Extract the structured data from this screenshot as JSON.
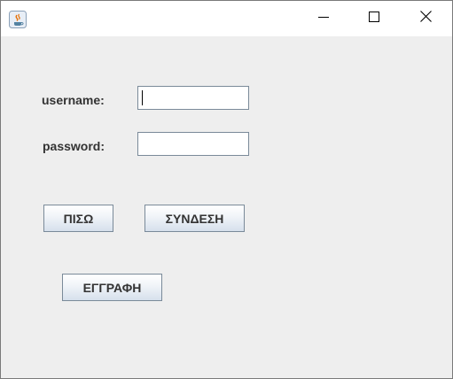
{
  "window": {
    "title": "",
    "icon": "java-icon",
    "controls": [
      "minimize-icon",
      "maximize-icon",
      "close-icon"
    ]
  },
  "form": {
    "username_label": "username:",
    "password_label": "password:",
    "username_value": "",
    "password_value": ""
  },
  "buttons": {
    "back_label": "ΠΙΣΩ",
    "login_label": "ΣΥΝΔΕΣΗ",
    "register_label": "ΕΓΓΡΑΦΗ"
  },
  "colors": {
    "background": "#eeeeee",
    "field_border": "#7a8a99",
    "button_gradient_bottom": "#d6e0ec"
  }
}
